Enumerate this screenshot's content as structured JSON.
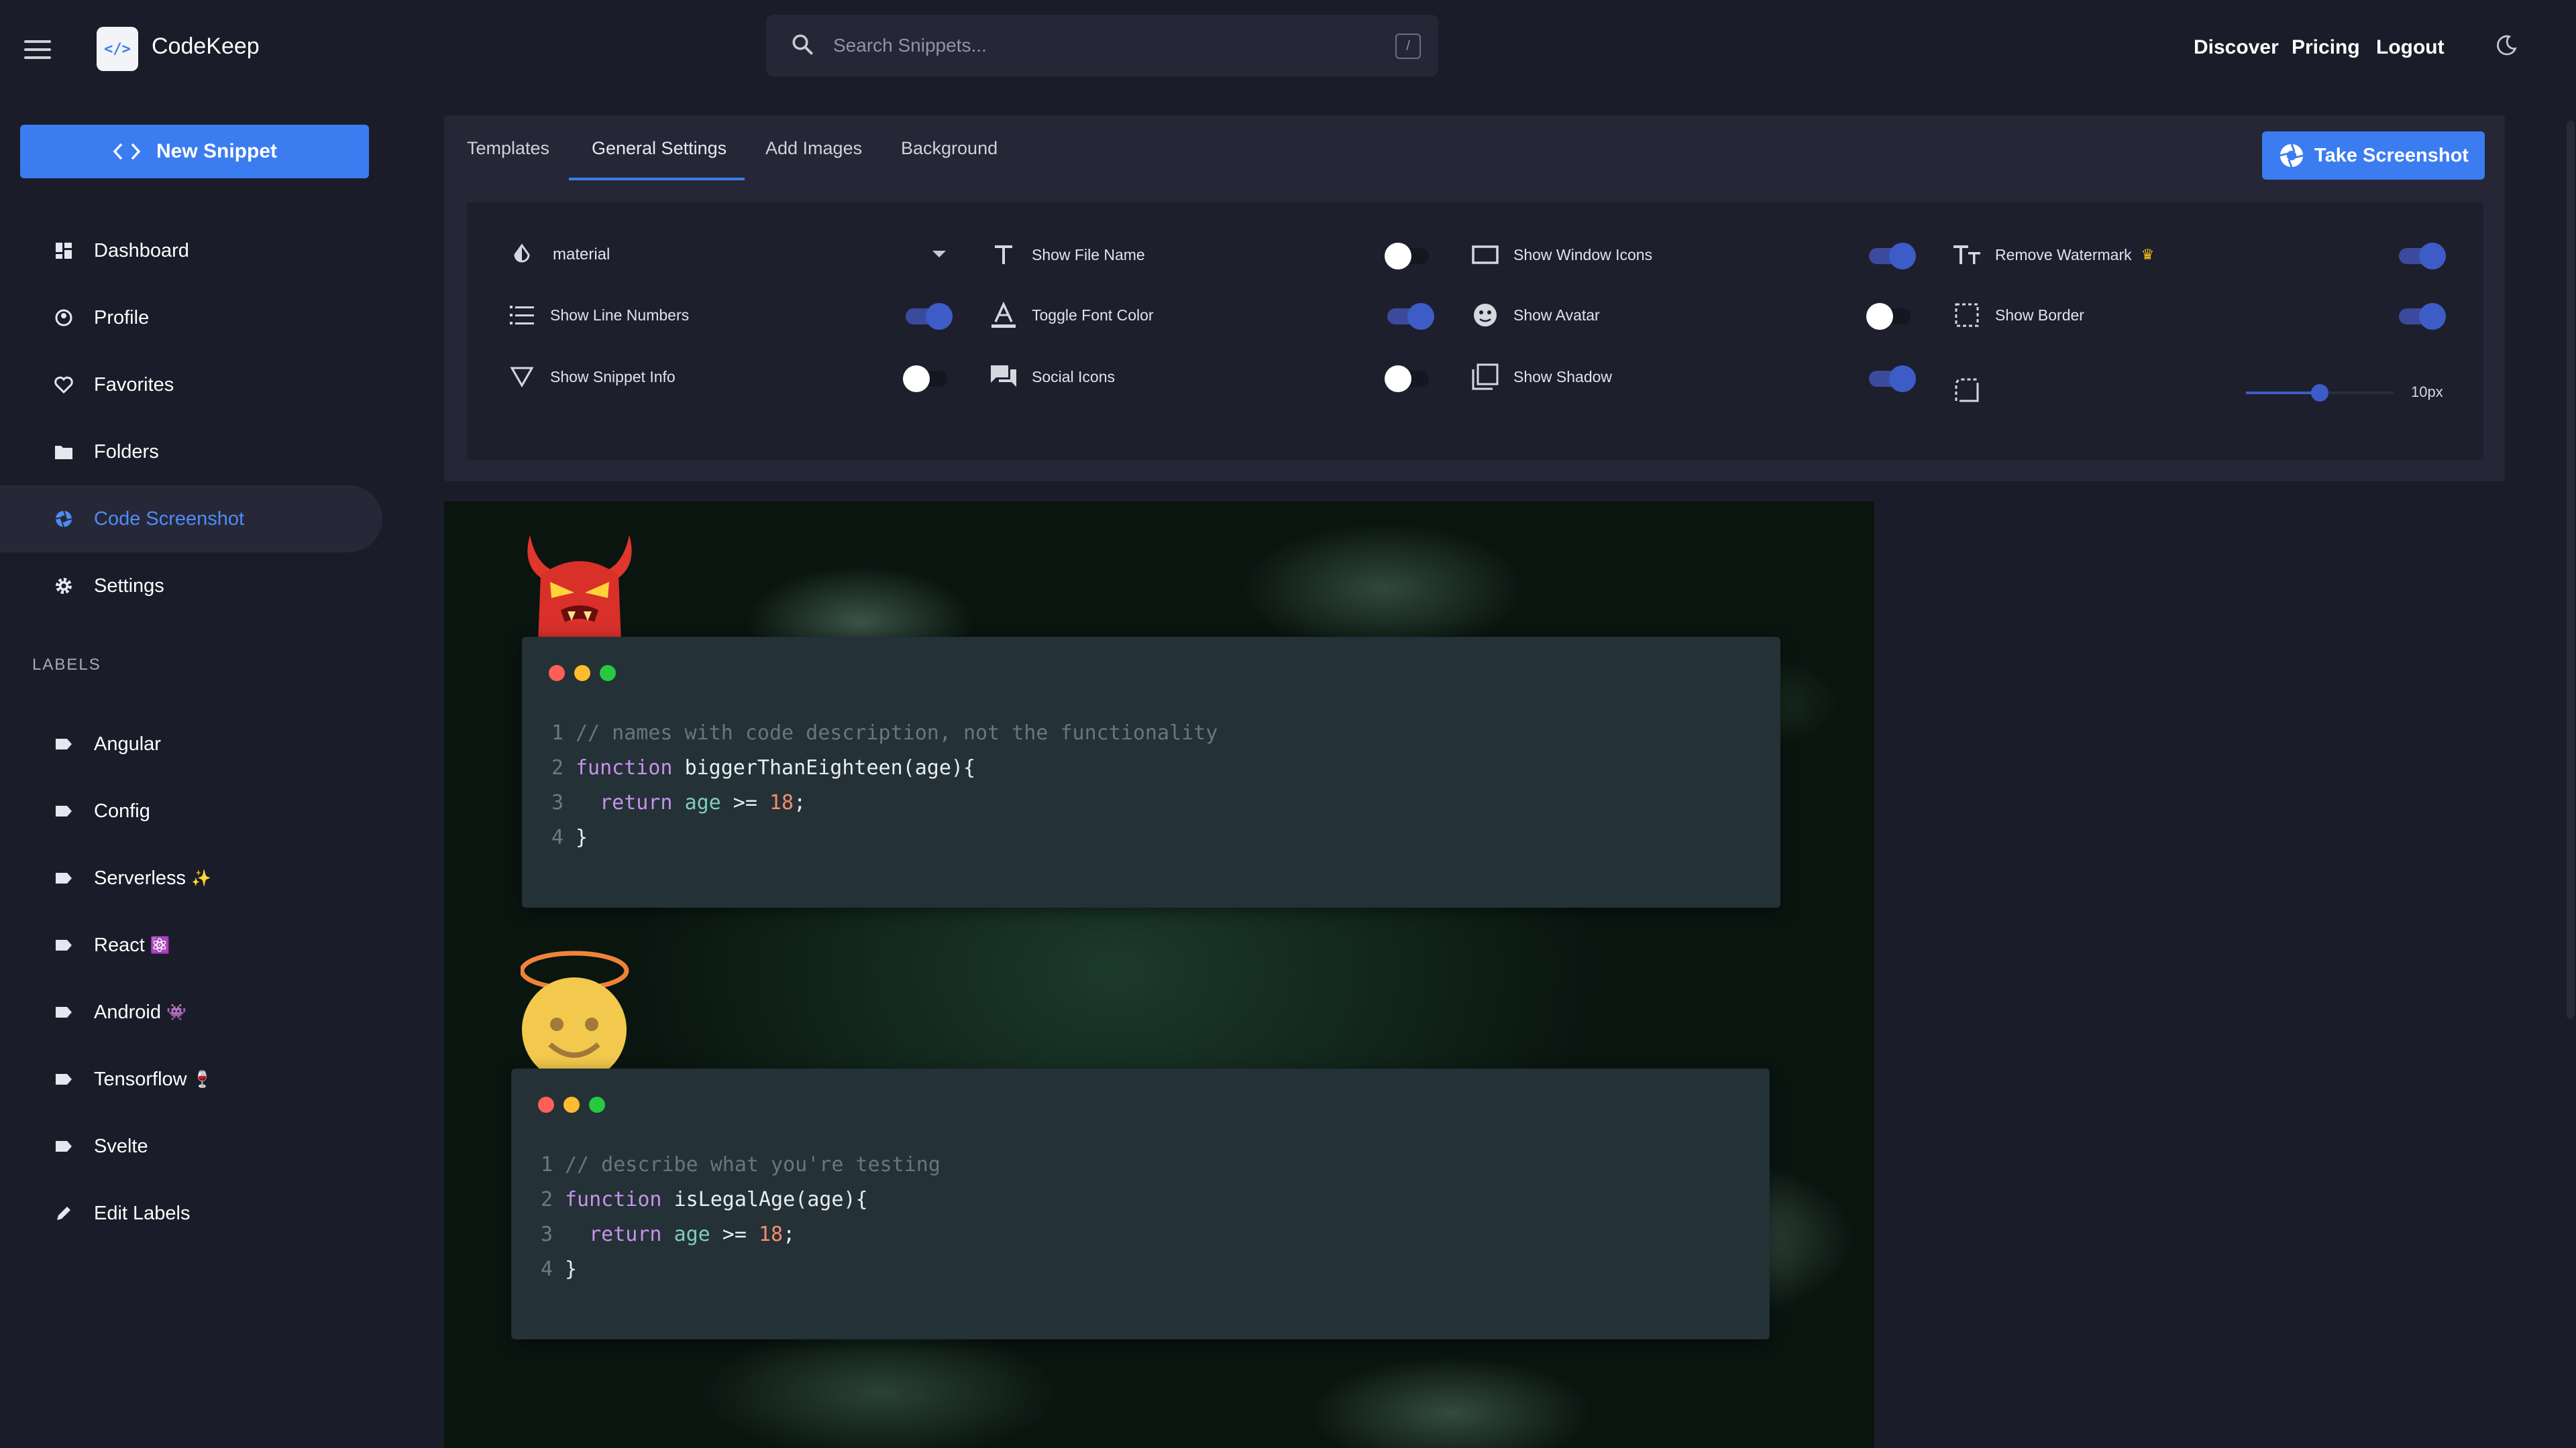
{
  "app": {
    "brand": "CodeKeep",
    "logo_glyph": "</>"
  },
  "header": {
    "search_placeholder": "Search Snippets...",
    "search_shortcut": "/",
    "nav": [
      "Discover",
      "Pricing",
      "Logout"
    ]
  },
  "sidebar": {
    "new_snippet": "New Snippet",
    "items": [
      {
        "label": "Dashboard",
        "icon": "dashboard-icon"
      },
      {
        "label": "Profile",
        "icon": "profile-icon"
      },
      {
        "label": "Favorites",
        "icon": "heart-icon"
      },
      {
        "label": "Folders",
        "icon": "folder-icon"
      },
      {
        "label": "Code Screenshot",
        "icon": "camera-shutter-icon",
        "active": true
      },
      {
        "label": "Settings",
        "icon": "gear-icon"
      }
    ],
    "labels_heading": "LABELS",
    "labels": [
      {
        "label": "Angular",
        "emoji": ""
      },
      {
        "label": "Config",
        "emoji": ""
      },
      {
        "label": "Serverless",
        "emoji": "✨"
      },
      {
        "label": "React",
        "emoji": "⚛️"
      },
      {
        "label": "Android",
        "emoji": "👾"
      },
      {
        "label": "Tensorflow",
        "emoji": "🍷"
      },
      {
        "label": "Svelte",
        "emoji": ""
      }
    ],
    "edit_labels": "Edit Labels"
  },
  "settings": {
    "tabs": [
      "Templates",
      "General Settings",
      "Add Images",
      "Background"
    ],
    "active_tab": "General Settings",
    "take_screenshot": "Take Screenshot",
    "theme": "material",
    "options": {
      "show_line_numbers": {
        "label": "Show Line Numbers",
        "on": true
      },
      "show_snippet_info": {
        "label": "Show Snippet Info",
        "on": false
      },
      "show_file_name": {
        "label": "Show File Name",
        "on": false
      },
      "toggle_font_color": {
        "label": "Toggle Font Color",
        "on": true
      },
      "social_icons": {
        "label": "Social Icons",
        "on": false
      },
      "show_window_icons": {
        "label": "Show Window Icons",
        "on": true
      },
      "show_avatar": {
        "label": "Show Avatar",
        "on": false
      },
      "show_shadow": {
        "label": "Show Shadow",
        "on": true
      },
      "remove_watermark": {
        "label": "Remove Watermark",
        "on": true,
        "badge": "♛"
      },
      "show_border": {
        "label": "Show Border",
        "on": true
      }
    },
    "border_radius": {
      "value": 10,
      "display": "10px",
      "fraction": 0.5
    }
  },
  "canvas": {
    "snippets": [
      {
        "avatar": "devil-emoji",
        "lines": [
          "// names with code description, not the functionality",
          "function biggerThanEighteen(age){",
          "  return age >= 18;",
          "}"
        ]
      },
      {
        "avatar": "angel-emoji",
        "lines": [
          "// describe what you're testing",
          "function isLegalAge(age){",
          "  return age >= 18;",
          "}"
        ]
      }
    ],
    "window_dot_colors": [
      "#ff5f57",
      "#febc2e",
      "#28c840"
    ]
  },
  "colors": {
    "accent": "#3b7cf0",
    "toggle_on": "#3d5cc8",
    "background": "#1b1c29"
  }
}
